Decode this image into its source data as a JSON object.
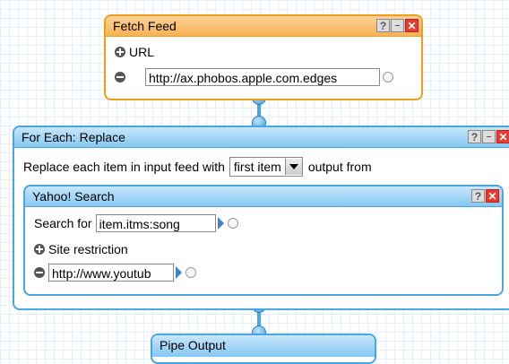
{
  "fetch_feed": {
    "title": "Fetch Feed",
    "help_btn": "?",
    "min_btn": "–",
    "close_btn": "✕",
    "url_label": "URL",
    "url_value": "http://ax.phobos.apple.com.edges"
  },
  "for_each": {
    "title": "For Each: Replace",
    "help_btn": "?",
    "min_btn": "–",
    "close_btn": "✕",
    "replace_label": "Replace each item in input feed with",
    "select_value": "first item",
    "output_label": "output from"
  },
  "yahoo_search": {
    "title": "Yahoo! Search",
    "help_btn": "?",
    "close_btn": "✕",
    "search_label": "Search for",
    "search_value": "item.itms:song",
    "site_label": "Site restriction",
    "site_value": "http://www.youtub"
  },
  "pipe_output": {
    "title": "Pipe Output"
  },
  "colors": {
    "orange": "#f29c1b",
    "blue": "#4aa6e0",
    "close_red": "#e83a2c"
  }
}
